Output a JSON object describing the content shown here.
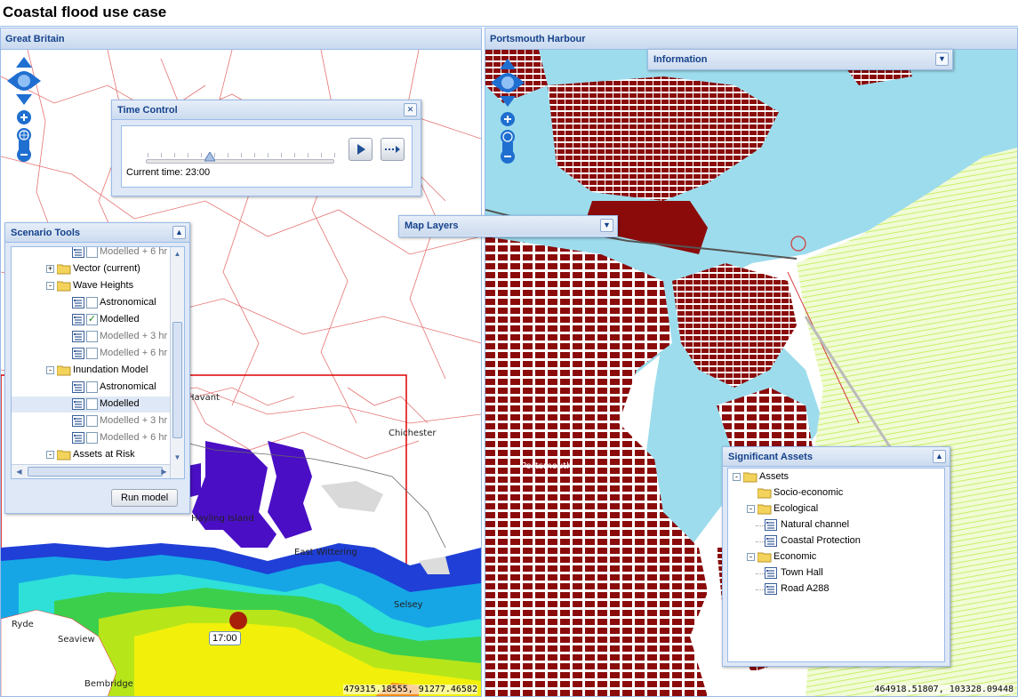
{
  "app": {
    "title": "Coastal flood use case"
  },
  "left_pane": {
    "title": "Great Britain",
    "coordinates": "479315.18555, 91277.46582",
    "places": [
      "Havant",
      "Chichester",
      "Hayling Island",
      "East Wittering",
      "Selsey",
      "Ryde",
      "Seaview",
      "Bembridge"
    ],
    "time_marker": "17:00"
  },
  "right_pane": {
    "title": "Portsmouth Harbour",
    "coordinates": "464918.51807, 103328.09448",
    "places": [
      "Portsmouth"
    ]
  },
  "time_control": {
    "title": "Time Control",
    "current_time_label": "Current time: 23:00",
    "slider_fraction": 0.34,
    "close_icon": "close-icon",
    "play_icon": "play-icon",
    "step_icon": "step-forward-icon"
  },
  "scenario_tools": {
    "title": "Scenario Tools",
    "run_button": "Run model",
    "rows": [
      {
        "label": "Modelled + 6 hr",
        "kind": "layer",
        "checked": false,
        "disabled": true
      },
      {
        "label": "Vector (current)",
        "kind": "folder",
        "expander": "+"
      },
      {
        "label": "Wave Heights",
        "kind": "folder",
        "expander": "-"
      },
      {
        "label": "Astronomical",
        "kind": "layer",
        "checked": false
      },
      {
        "label": "Modelled",
        "kind": "layer",
        "checked": true
      },
      {
        "label": "Modelled + 3 hr",
        "kind": "layer",
        "checked": false,
        "disabled": true
      },
      {
        "label": "Modelled + 6 hr",
        "kind": "layer",
        "checked": false,
        "disabled": true
      },
      {
        "label": "Inundation Model",
        "kind": "folder",
        "expander": "-"
      },
      {
        "label": "Astronomical",
        "kind": "layer",
        "checked": false
      },
      {
        "label": "Modelled",
        "kind": "layer",
        "checked": false,
        "selected": true
      },
      {
        "label": "Modelled + 3 hr",
        "kind": "layer",
        "checked": false,
        "disabled": true
      },
      {
        "label": "Modelled + 6 hr",
        "kind": "layer",
        "checked": false,
        "disabled": true
      },
      {
        "label": "Assets at Risk",
        "kind": "folder",
        "expander": "-"
      }
    ]
  },
  "map_layers": {
    "title": "Map Layers"
  },
  "information": {
    "title": "Information"
  },
  "significant_assets": {
    "title": "Significant Assets",
    "rows": [
      {
        "label": "Assets",
        "level": 0,
        "kind": "folder",
        "expander": "-"
      },
      {
        "label": "Socio-economic",
        "level": 1,
        "kind": "folder"
      },
      {
        "label": "Ecological",
        "level": 1,
        "kind": "folder",
        "expander": "-"
      },
      {
        "label": "Natural channel",
        "level": 2,
        "kind": "layer"
      },
      {
        "label": "Coastal Protection",
        "level": 2,
        "kind": "layer"
      },
      {
        "label": "Economic",
        "level": 1,
        "kind": "folder",
        "expander": "-"
      },
      {
        "label": "Town Hall",
        "level": 2,
        "kind": "layer"
      },
      {
        "label": "Road A288",
        "level": 2,
        "kind": "layer"
      }
    ]
  },
  "colors": {
    "water_deep": "#1f3fd6",
    "water_mid": "#16a6e6",
    "water_cyan": "#2ee0d8",
    "water_green": "#3ccf4c",
    "water_lime": "#b6e61a",
    "water_yellow": "#f2f00a",
    "flood_purple": "#4a0fc4",
    "harbour_water": "#9ddcec",
    "buildings": "#8b0b0b",
    "vegetation": "#c8f06a",
    "roads": "#d23a3a"
  }
}
